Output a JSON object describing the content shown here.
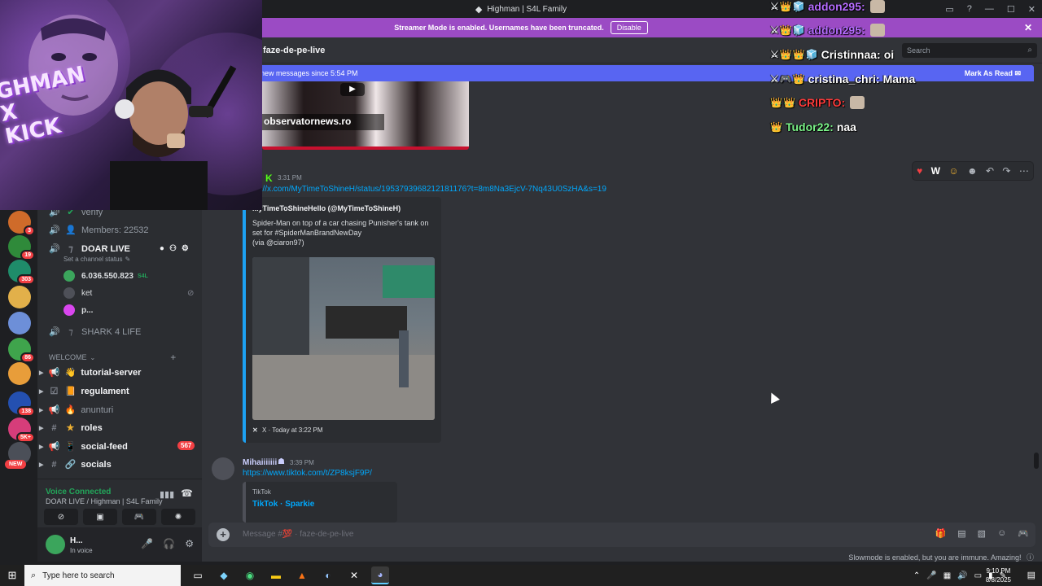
{
  "window": {
    "title": "Highman | S4L Family"
  },
  "banner": {
    "text": "Streamer Mode is enabled. Usernames have been truncated.",
    "button": "Disable"
  },
  "servers": [
    {
      "color": "#cf6b2a",
      "badge": "3"
    },
    {
      "color": "#2f8a3a",
      "badge": "19"
    },
    {
      "color": "#1f8c6a",
      "badge": "303"
    },
    {
      "color": "#e2b04a",
      "badge": ""
    },
    {
      "color": "#6d8fd8",
      "badge": ""
    },
    {
      "color": "#3fa44c",
      "badge": "86"
    },
    {
      "color": "#e89d3a",
      "badge": ""
    },
    {
      "color": "#2450b0",
      "badge": "138"
    },
    {
      "color": "#d63d7a",
      "badge": "5K+"
    },
    {
      "color": "#4b4f58",
      "badge": ""
    }
  ],
  "new_badge": "NEW",
  "sidebar": {
    "verify": "verify",
    "members": "Members: 22532",
    "doar_live": "DOAR LIVE",
    "channel_status": "Set a channel status",
    "voice_users": [
      "6.036.550.823",
      "ket",
      "p..."
    ],
    "voice_user_tag": "S4L",
    "shark": "SHARK 4 LIFE",
    "category": "WELCOME",
    "channels": [
      "tutorial-server",
      "regulament",
      "anunturi",
      "roles",
      "social-feed",
      "socials"
    ],
    "social_feed_mentions": "567"
  },
  "voice_panel": {
    "title": "Voice Connected",
    "subtitle": "DOAR LIVE / Highman | S4L Family"
  },
  "userbar": {
    "name": "H...",
    "status": "In voice"
  },
  "main": {
    "channel": "faze-de-pe-live",
    "search_placeholder": "Search",
    "new_messages": "new messages since 5:54 PM",
    "mark_read": "Mark As Read",
    "top_embed_source": "observatornews.ro",
    "msg1": {
      "time": "3:31 PM",
      "link": "https://x.com/MyTimeToShineH/status/1953793968212181176?t=8m8Na3EjcV-7Nq43U0SzHA&s=19",
      "embed_author": "MyTimeToShineHello (@MyTimeToShineH)",
      "embed_desc": [
        "Spider-Man on top of a car chasing Punisher's tank on",
        "set for #SpiderManBrandNewDay",
        "(via @ciaron97)"
      ],
      "embed_footer": "X · Today at 3:22 PM"
    },
    "msg2": {
      "author": "Mihaiiiiiii",
      "time": "3:39 PM",
      "link": "https://www.tiktok.com/t/ZP8ksjF9P/",
      "embed_provider": "TikTok",
      "embed_title": "TikTok · Sparkie"
    },
    "composer_placeholder": "Message #💯 · faze-de-pe-live",
    "slowmode": "Slowmode is enabled, but you are immune. Amazing!"
  },
  "chat_overlay": [
    {
      "badges": "⚔👑🧊",
      "user": "addon295:",
      "color": "#b56cff",
      "text": "",
      "emote": true
    },
    {
      "badges": "⚔👑🧊",
      "user": "addon295:",
      "color": "#b56cff",
      "text": "",
      "emote": true
    },
    {
      "badges": "⚔👑👑🧊",
      "user": "Cristinnaa:",
      "color": "#ffffff",
      "text": "oi",
      "emote": false
    },
    {
      "badges": "⚔🎮👑",
      "user": "cristina_chri:",
      "color": "#ffffff",
      "text": "Mama",
      "emote": false
    },
    {
      "badges": "👑👑",
      "user": "CRIPTO:",
      "color": "#ff3b3b",
      "text": "",
      "emote": true
    },
    {
      "badges": "👑",
      "user": "Tudor22:",
      "color": "#7cf58a",
      "text": "naa",
      "emote": false
    }
  ],
  "webcam": {
    "graffiti": "GHMAN X KICK"
  },
  "taskbar": {
    "search_placeholder": "Type here to search",
    "time": "9:10 PM",
    "date": "8/8/2025"
  }
}
